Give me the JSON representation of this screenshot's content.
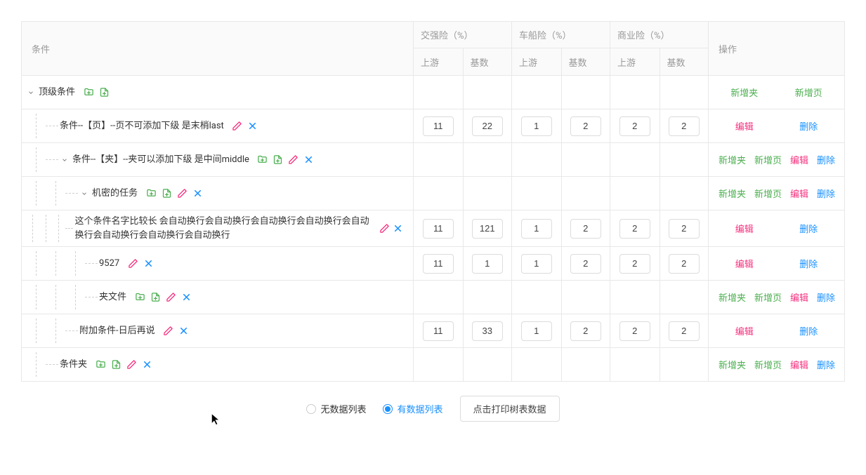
{
  "header": {
    "condition": "条件",
    "groups": [
      {
        "title": "交强险（%）",
        "sub1": "上游",
        "sub2": "基数"
      },
      {
        "title": "车船险（%）",
        "sub1": "上游",
        "sub2": "基数"
      },
      {
        "title": "商业险（%）",
        "sub1": "上游",
        "sub2": "基数"
      }
    ],
    "ops": "操作"
  },
  "actions": {
    "add_folder": "新增夹",
    "add_page": "新增页",
    "edit": "编辑",
    "delete": "删除"
  },
  "rows": [
    {
      "id": "root",
      "depth": 0,
      "type": "folder",
      "expanded": true,
      "label": "顶级条件",
      "icons": [
        "add-folder",
        "add-page"
      ],
      "values": null,
      "ops": [
        "add_folder",
        "add_page"
      ]
    },
    {
      "id": "r1",
      "depth": 1,
      "type": "page",
      "expanded": null,
      "label": "条件--【页】--页不可添加下级 是末梢last",
      "icons": [
        "edit",
        "delete"
      ],
      "values": [
        "11",
        "22",
        "1",
        "2",
        "2",
        "2"
      ],
      "ops": [
        "edit",
        "delete"
      ]
    },
    {
      "id": "r2",
      "depth": 1,
      "type": "folder",
      "expanded": true,
      "label": "条件--【夹】--夹可以添加下级 是中间middle",
      "icons": [
        "add-folder",
        "add-page",
        "edit",
        "delete"
      ],
      "values": null,
      "ops": [
        "add_folder",
        "add_page",
        "edit",
        "delete"
      ]
    },
    {
      "id": "r3",
      "depth": 2,
      "type": "folder",
      "expanded": true,
      "label": "机密的任务",
      "icons": [
        "add-folder",
        "add-page",
        "edit",
        "delete"
      ],
      "values": null,
      "ops": [
        "add_folder",
        "add_page",
        "edit",
        "delete"
      ]
    },
    {
      "id": "r4",
      "depth": 3,
      "type": "page",
      "expanded": null,
      "label": "这个条件名字比较长 会自动换行会自动换行会自动换行会自动换行会自动换行会自动换行会自动换行会自动换行",
      "icons": [
        "edit",
        "delete"
      ],
      "values": [
        "11",
        "121",
        "1",
        "2",
        "2",
        "2"
      ],
      "ops": [
        "edit",
        "delete"
      ]
    },
    {
      "id": "r5",
      "depth": 3,
      "type": "page",
      "expanded": null,
      "label": "9527",
      "icons": [
        "edit",
        "delete"
      ],
      "values": [
        "11",
        "1",
        "1",
        "2",
        "2",
        "2"
      ],
      "ops": [
        "edit",
        "delete"
      ]
    },
    {
      "id": "r6",
      "depth": 3,
      "type": "folder",
      "expanded": null,
      "label": "夹文件",
      "icons": [
        "add-folder",
        "add-page",
        "edit",
        "delete"
      ],
      "values": null,
      "ops": [
        "add_folder",
        "add_page",
        "edit",
        "delete"
      ]
    },
    {
      "id": "r7",
      "depth": 2,
      "type": "page",
      "expanded": null,
      "label": "附加条件-日后再说",
      "icons": [
        "edit",
        "delete"
      ],
      "values": [
        "11",
        "33",
        "1",
        "2",
        "2",
        "2"
      ],
      "ops": [
        "edit",
        "delete"
      ]
    },
    {
      "id": "r8",
      "depth": 1,
      "type": "folder",
      "expanded": null,
      "label": "条件夹",
      "icons": [
        "add-folder",
        "add-page",
        "edit",
        "delete"
      ],
      "values": null,
      "ops": [
        "add_folder",
        "add_page",
        "edit",
        "delete"
      ]
    }
  ],
  "footer": {
    "radio_nodata": "无数据列表",
    "radio_withdata": "有数据列表",
    "selected": "withdata",
    "print_btn": "点击打印树表数据"
  }
}
